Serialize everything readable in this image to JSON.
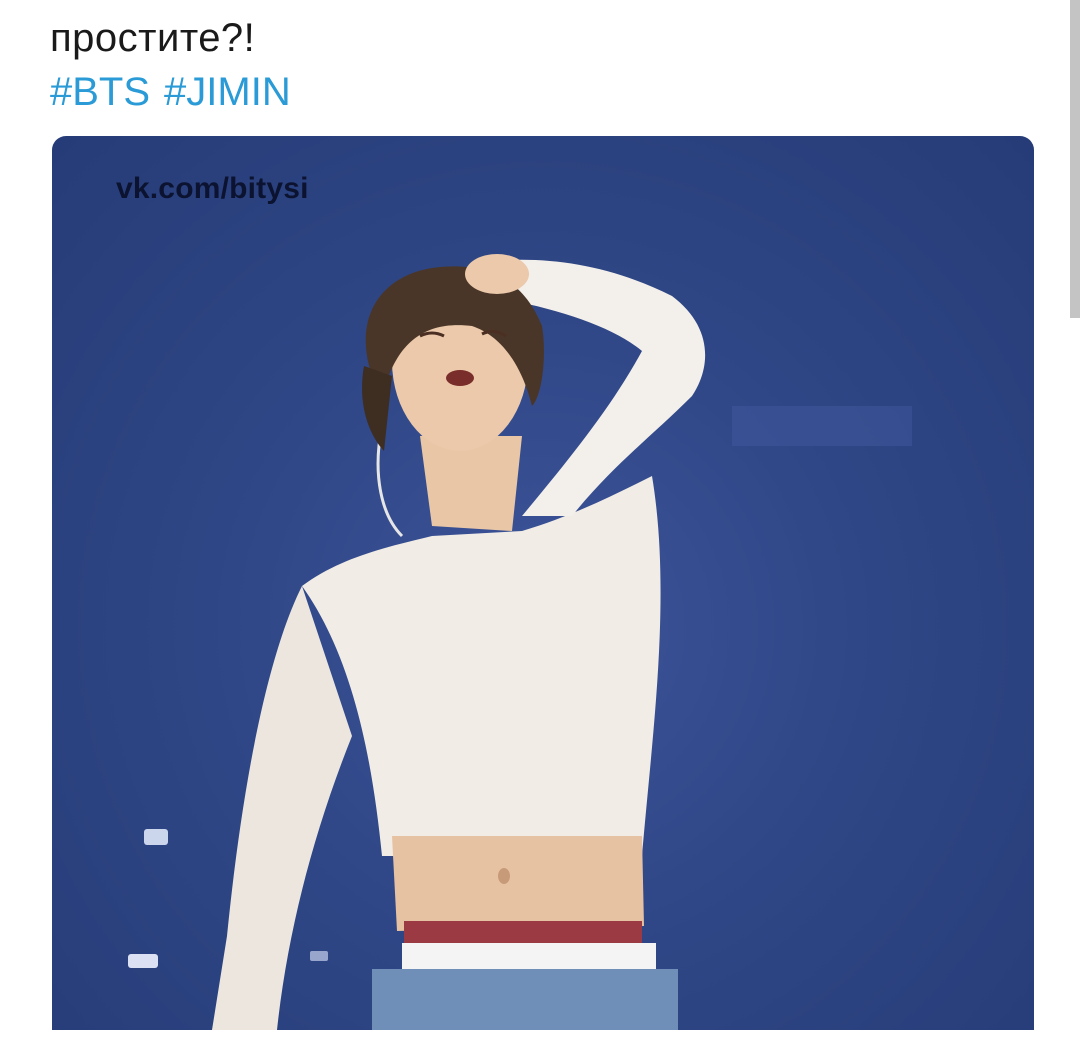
{
  "post": {
    "text": "простите?!",
    "hashtags": [
      "#BTS",
      "#JIMIN"
    ],
    "link_color": "#2a9bd6"
  },
  "media": {
    "watermark": "vk.com/bitysi",
    "background_color": "#2f4786"
  }
}
